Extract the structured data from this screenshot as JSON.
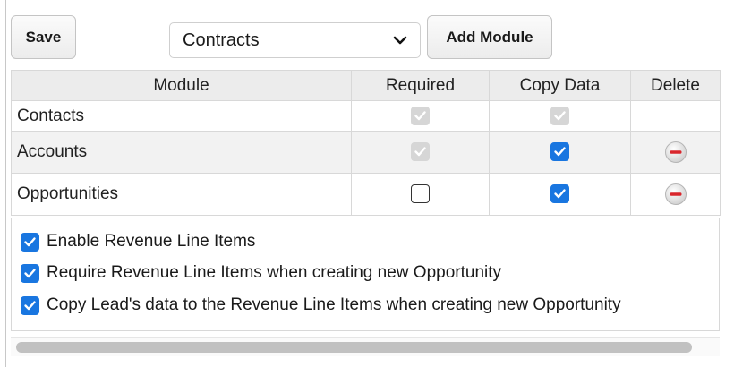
{
  "toolbar": {
    "save_label": "Save",
    "module_select_value": "Contracts",
    "add_module_label": "Add Module"
  },
  "table": {
    "headers": [
      "Module",
      "Required",
      "Copy Data",
      "Delete"
    ],
    "rows": [
      {
        "module": "Contacts",
        "required": "checked-disabled",
        "copy_data": "checked-disabled",
        "delete": false
      },
      {
        "module": "Accounts",
        "required": "checked-disabled",
        "copy_data": "checked",
        "delete": true
      },
      {
        "module": "Opportunities",
        "required": "unchecked",
        "copy_data": "checked",
        "delete": true
      }
    ]
  },
  "options": [
    {
      "label": "Enable Revenue Line Items",
      "checked": true
    },
    {
      "label": "Require Revenue Line Items when creating new Opportunity",
      "checked": true
    },
    {
      "label": "Copy Lead's data to the Revenue Line Items when creating new Opportunity",
      "checked": true
    }
  ],
  "colors": {
    "checkbox_checked": "#1976e0",
    "checkbox_disabled": "#d6d6d6",
    "delete_icon": "#d9262c"
  },
  "icons": {
    "select_arrow": "chevron-down-icon",
    "delete": "remove-circle-icon",
    "check": "checkmark-icon"
  }
}
